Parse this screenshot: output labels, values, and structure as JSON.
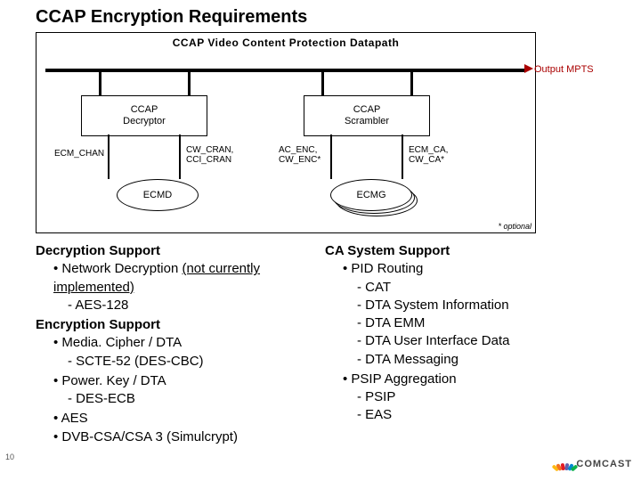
{
  "title": "CCAP Encryption Requirements",
  "diagram": {
    "header": "CCAP Video Content Protection Datapath",
    "decryptor": "CCAP\nDecryptor",
    "scrambler": "CCAP\nScrambler",
    "output": "Output MPTS",
    "ecm_chan": "ECM_CHAN",
    "cw_cran": "CW_CRAN,\nCCI_CRAN",
    "ac_enc": "AC_ENC,\nCW_ENC*",
    "ecm_ca": "ECM_CA,\nCW_CA*",
    "ecmd": "ECMD",
    "ecmg": "ECMG",
    "footnote": "* optional"
  },
  "left": {
    "h1": "Decryption Support",
    "b1": "Network Decryption ",
    "b1_note": "(not currently implemented)",
    "b1_s1": "AES-128",
    "h2": "Encryption Support",
    "b2": "Media. Cipher / DTA",
    "b2_s1": "SCTE-52 (DES-CBC)",
    "b3": "Power. Key / DTA",
    "b3_s1": "DES-ECB",
    "b4": "AES",
    "b5": "DVB-CSA/CSA 3 (Simulcrypt)"
  },
  "right": {
    "h1": "CA System Support",
    "b1": "PID Routing",
    "b1_s1": "CAT",
    "b1_s2": "DTA System Information",
    "b1_s3": "DTA EMM",
    "b1_s4": "DTA User Interface Data",
    "b1_s5": "DTA Messaging",
    "b2": "PSIP Aggregation",
    "b2_s1": "PSIP",
    "b2_s2": "EAS"
  },
  "page_number": "10",
  "logo_text": "COMCAST",
  "peacock_colors": [
    "#fdb913",
    "#f37021",
    "#e31b23",
    "#6460aa",
    "#0089cf",
    "#0db14b"
  ]
}
